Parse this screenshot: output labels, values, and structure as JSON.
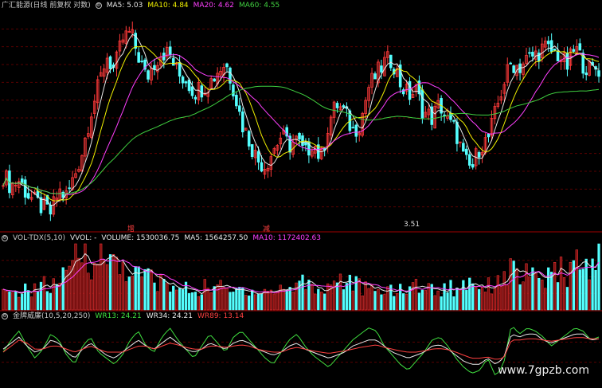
{
  "main_header": {
    "title": "广汇能源(日线 前复权 对数)",
    "items": [
      {
        "label": "MA5: 5.03",
        "color": "#e8e8e8"
      },
      {
        "label": "MA10: 4.84",
        "color": "#f0f000"
      },
      {
        "label": "MA20: 4.62",
        "color": "#ff40ff"
      },
      {
        "label": "MA60: 4.55",
        "color": "#40d040"
      }
    ]
  },
  "vol_header": {
    "title": "VOL-TDX(5,10)",
    "items": [
      {
        "label": "VVOL: -",
        "color": "#e8e8e8"
      },
      {
        "label": "VOLUME: 1530036.75",
        "color": "#e8e8e8"
      },
      {
        "label": "MA5: 1564257.50",
        "color": "#e8e8e8"
      },
      {
        "label": "MA10: 1172402.63",
        "color": "#ff40ff"
      }
    ]
  },
  "ind_header": {
    "title": "金牌威廉(10,5,20,250)",
    "items": [
      {
        "label": "WR13: 24.21",
        "color": "#40e040"
      },
      {
        "label": "WR34: 24.21",
        "color": "#e8e8e8"
      },
      {
        "label": "WR89: 13.14",
        "color": "#ff4040"
      }
    ]
  },
  "markers": {
    "m1": "增",
    "m2": "减",
    "price_note": "3.51"
  },
  "watermark": "www.7gpzb.com",
  "chart_data": [
    {
      "type": "candlestick",
      "title": "广汇能源(日线 前复权 对数)",
      "series": [
        {
          "name": "MA5",
          "value": 5.03
        },
        {
          "name": "MA10",
          "value": 4.84
        },
        {
          "name": "MA20",
          "value": 4.62
        },
        {
          "name": "MA60",
          "value": 4.55
        }
      ],
      "ylim": [
        3.5,
        5.9
      ],
      "grid": true,
      "close_path": [
        3.95,
        3.85,
        3.9,
        3.78,
        3.7,
        3.65,
        3.6,
        3.8,
        3.75,
        3.95,
        4.2,
        4.6,
        4.9,
        5.3,
        5.1,
        5.5,
        5.6,
        5.3,
        5.0,
        5.2,
        5.35,
        5.3,
        5.05,
        5.0,
        4.85,
        4.9,
        4.95,
        5.1,
        5.2,
        4.9,
        4.5,
        4.3,
        4.1,
        4.05,
        4.2,
        4.35,
        4.25,
        4.3,
        4.15,
        4.3,
        4.1,
        4.5,
        4.7,
        4.6,
        4.4,
        4.5,
        4.9,
        5.05,
        5.2,
        5.25,
        4.95,
        4.8,
        4.85,
        4.6,
        4.55,
        4.7,
        4.5,
        4.4,
        4.1,
        4.0,
        4.25,
        4.3,
        4.6,
        4.95,
        5.2,
        5.15,
        5.25,
        5.3,
        5.4,
        5.35,
        5.3,
        5.15,
        5.4,
        5.2,
        5.1,
        5.15
      ],
      "last_close": 5.03,
      "min_label": 3.51
    },
    {
      "type": "bar",
      "title": "VOL-TDX(5,10)",
      "series": [
        {
          "name": "VOLUME",
          "value": 1530036.75
        },
        {
          "name": "MA5",
          "value": 1564257.5
        },
        {
          "name": "MA10",
          "value": 1172402.63
        }
      ],
      "volume_path": [
        0.25,
        0.2,
        0.3,
        0.28,
        0.35,
        0.4,
        0.3,
        0.5,
        0.45,
        0.8,
        0.9,
        0.75,
        0.85,
        0.7,
        0.8,
        0.65,
        0.6,
        0.5,
        0.55,
        0.45,
        0.4,
        0.35,
        0.3,
        0.32,
        0.28,
        0.3,
        0.4,
        0.35,
        0.3,
        0.25,
        0.35,
        0.3,
        0.28,
        0.3,
        0.25,
        0.35,
        0.3,
        0.4,
        0.45,
        0.35,
        0.3,
        0.35,
        0.5,
        0.45,
        0.4,
        0.35,
        0.3,
        0.25,
        0.3,
        0.35,
        0.28,
        0.3,
        0.4,
        0.35,
        0.3,
        0.3,
        0.35,
        0.3,
        0.4,
        0.45,
        0.4,
        0.35,
        0.45,
        0.5,
        0.6,
        0.55,
        0.5,
        0.45,
        0.5,
        0.45,
        0.6,
        0.55,
        0.7,
        0.6,
        0.65,
        0.9
      ],
      "grid": true
    },
    {
      "type": "line",
      "title": "金牌威廉(10,5,20,250)",
      "series": [
        {
          "name": "WR13",
          "value": 24.21,
          "path": [
            50,
            70,
            85,
            60,
            40,
            55,
            80,
            70,
            45,
            30,
            60,
            75,
            50,
            40,
            30,
            45,
            70,
            85,
            60,
            50,
            75,
            90,
            70,
            55,
            40,
            60,
            80,
            65,
            50,
            75,
            85,
            70,
            55,
            40,
            30,
            50,
            70,
            80,
            60,
            45,
            35,
            25,
            40,
            55,
            70,
            80,
            90,
            85,
            60,
            45,
            30,
            20,
            35,
            50,
            70,
            75,
            60,
            40,
            25,
            15,
            20,
            40,
            10,
            30,
            95,
            80,
            90,
            85,
            75,
            60,
            70,
            80,
            90,
            85,
            70,
            75
          ]
        },
        {
          "name": "WR34",
          "value": 24.21,
          "path": [
            55,
            65,
            75,
            60,
            50,
            55,
            70,
            65,
            50,
            40,
            55,
            65,
            55,
            45,
            40,
            50,
            60,
            70,
            60,
            55,
            65,
            75,
            65,
            55,
            50,
            55,
            65,
            60,
            55,
            65,
            70,
            65,
            55,
            50,
            45,
            50,
            60,
            65,
            55,
            50,
            45,
            40,
            45,
            50,
            60,
            65,
            70,
            70,
            60,
            50,
            45,
            40,
            45,
            50,
            60,
            62,
            55,
            45,
            35,
            30,
            30,
            40,
            30,
            40,
            80,
            75,
            80,
            80,
            70,
            65,
            70,
            75,
            80,
            80,
            70,
            72
          ]
        },
        {
          "name": "WR89",
          "value": 13.14,
          "path": [
            50,
            60,
            70,
            65,
            55,
            55,
            60,
            60,
            55,
            50,
            55,
            60,
            55,
            50,
            50,
            50,
            55,
            60,
            60,
            55,
            60,
            65,
            62,
            58,
            55,
            55,
            60,
            60,
            58,
            60,
            62,
            60,
            55,
            52,
            50,
            50,
            55,
            58,
            55,
            52,
            50,
            48,
            50,
            52,
            55,
            58,
            60,
            62,
            58,
            55,
            52,
            50,
            50,
            52,
            55,
            56,
            54,
            50,
            45,
            40,
            40,
            42,
            38,
            40,
            70,
            70,
            72,
            72,
            70,
            68,
            70,
            72,
            74,
            74,
            72,
            72
          ]
        }
      ],
      "ylim": [
        0,
        100
      ],
      "grid": true
    }
  ]
}
